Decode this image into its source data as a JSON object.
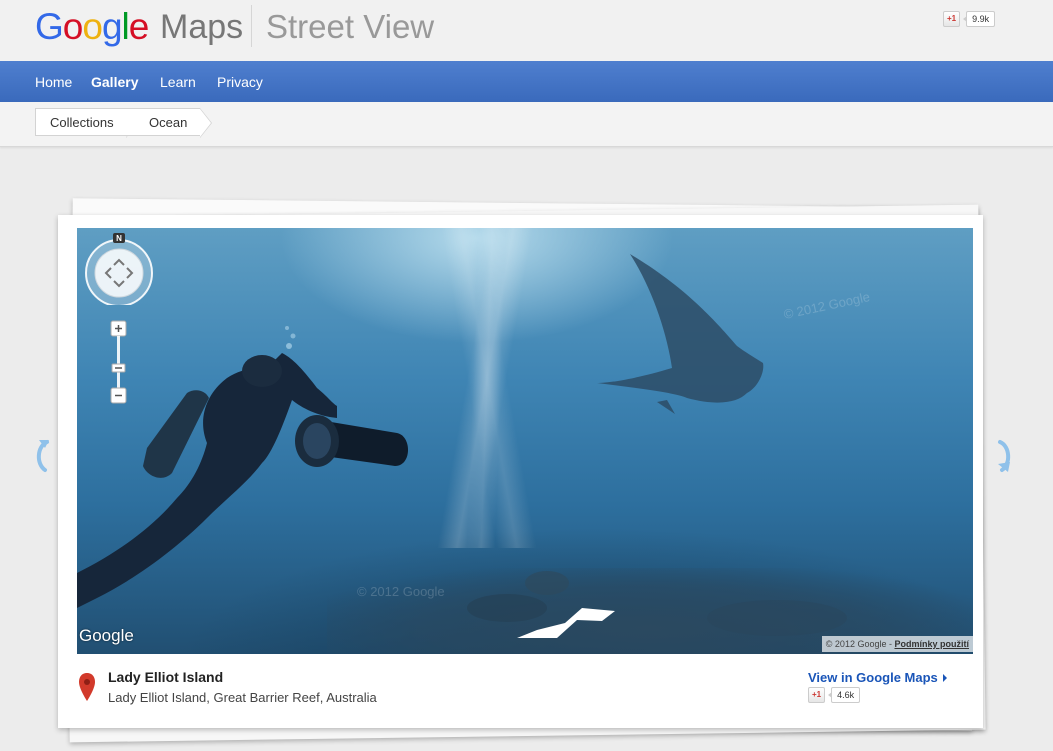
{
  "header": {
    "logo_letters": [
      "G",
      "o",
      "o",
      "g",
      "l",
      "e"
    ],
    "maps_label": "Maps",
    "product_label": "Street View",
    "plusone_label": "+1",
    "plusone_count": "9.9k"
  },
  "nav": {
    "items": [
      {
        "label": "Home",
        "active": false
      },
      {
        "label": "Gallery",
        "active": true
      },
      {
        "label": "Learn",
        "active": false
      },
      {
        "label": "Privacy",
        "active": false
      }
    ]
  },
  "breadcrumb": {
    "items": [
      "Collections",
      "Ocean"
    ]
  },
  "viewer": {
    "compass_north": "N",
    "zoom_in": "+",
    "zoom_out": "−",
    "google_watermark": "Google",
    "copyright_text": "© 2012 Google - ",
    "terms_text": "Podmínky použití",
    "faint_watermark": "© 2012 Google"
  },
  "caption": {
    "title": "Lady Elliot Island",
    "subtitle": "Lady Elliot Island, Great Barrier Reef, Australia",
    "view_link": "View in Google Maps",
    "plusone_label": "+1",
    "plusone_count": "4.6k"
  },
  "colors": {
    "nav_blue": "#4579c8",
    "link_blue": "#1a55b8",
    "pin_red": "#d23a2b",
    "arrow_blue": "#8fc1ea"
  }
}
